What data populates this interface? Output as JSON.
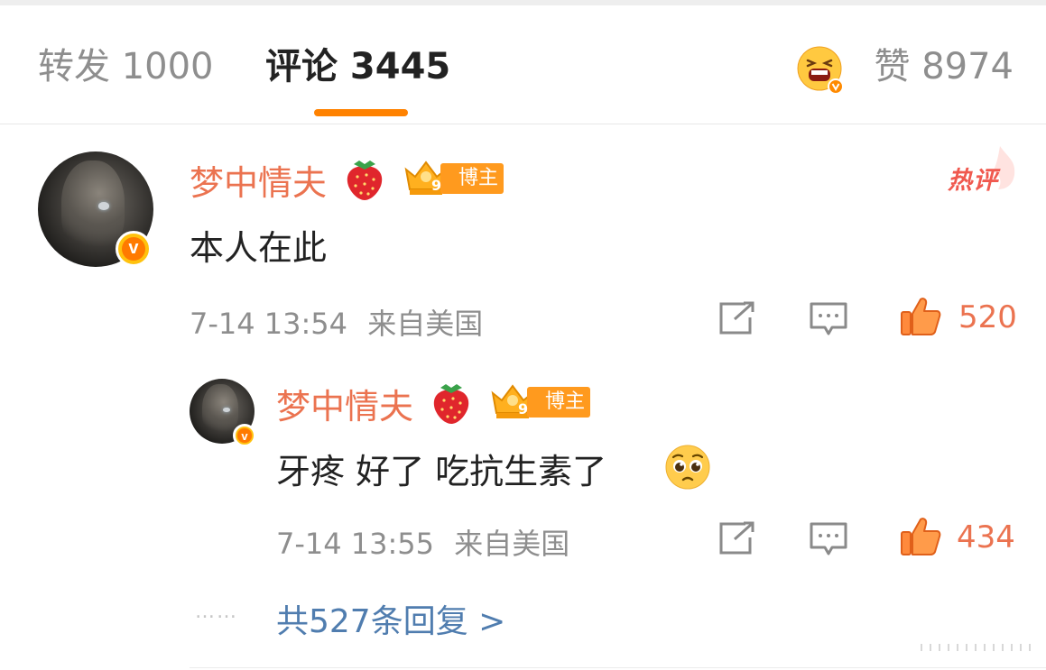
{
  "tabs": {
    "repost": "转发 1000",
    "comments": "评论 3445",
    "likes": "赞 8974",
    "active_color": "#ff8200"
  },
  "comment": {
    "username": "梦中情夫",
    "member_level": "9",
    "role_tag": "博主",
    "hot_badge": "热评",
    "text": "本人在此",
    "time": "7-14 13:54",
    "location": "来自美国",
    "likes": "520"
  },
  "reply": {
    "username": "梦中情夫",
    "member_level": "9",
    "role_tag": "博主",
    "text": "牙疼 好了 吃抗生素了",
    "time": "7-14 13:55",
    "location": "来自美国",
    "likes": "434"
  },
  "more_replies": "共527条回复 >",
  "dots": "……",
  "icons": {
    "repost": "share-arrow-icon",
    "reply": "chat-bubble-icon",
    "like": "thumbs-up-icon",
    "verified": "verified-v-badge-icon",
    "emoji": "pleading-face-icon"
  },
  "colors": {
    "username": "#eb7350",
    "link": "#507daf",
    "meta": "#8e8e8e",
    "hot": "#f0594f",
    "blogger_tag": "#ff9a1e"
  },
  "verified_letter": "v"
}
